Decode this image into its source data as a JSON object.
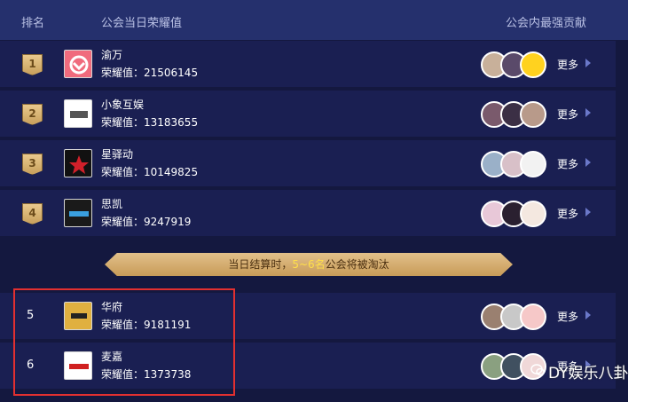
{
  "header": {
    "rank": "排名",
    "honor": "公会当日荣耀值",
    "contrib": "公会内最强贡献"
  },
  "rows": [
    {
      "rank": "1",
      "name": "渝万",
      "score": "荣耀值：21506145",
      "more": "更多"
    },
    {
      "rank": "2",
      "name": "小象互娱",
      "score": "荣耀值：13183655",
      "more": "更多"
    },
    {
      "rank": "3",
      "name": "星驿动",
      "score": "荣耀值：10149825",
      "more": "更多"
    },
    {
      "rank": "4",
      "name": "思凯",
      "score": "荣耀值：9247919",
      "more": "更多"
    },
    {
      "rank": "5",
      "name": "华府",
      "score": "荣耀值：9181191",
      "more": "更多"
    },
    {
      "rank": "6",
      "name": "麦嘉",
      "score": "荣耀值：1373738",
      "more": "更多"
    }
  ],
  "banner": {
    "pre": "当日结算时，",
    "highlight": "5~6名",
    "post": "公会将被淘汰"
  },
  "watermark": "DY娱乐八卦",
  "colors": {
    "background": "#14183f",
    "header": "#25306d",
    "row": "#1a1f52",
    "highlight_box": "#e23030",
    "medal": "#d8b270"
  }
}
